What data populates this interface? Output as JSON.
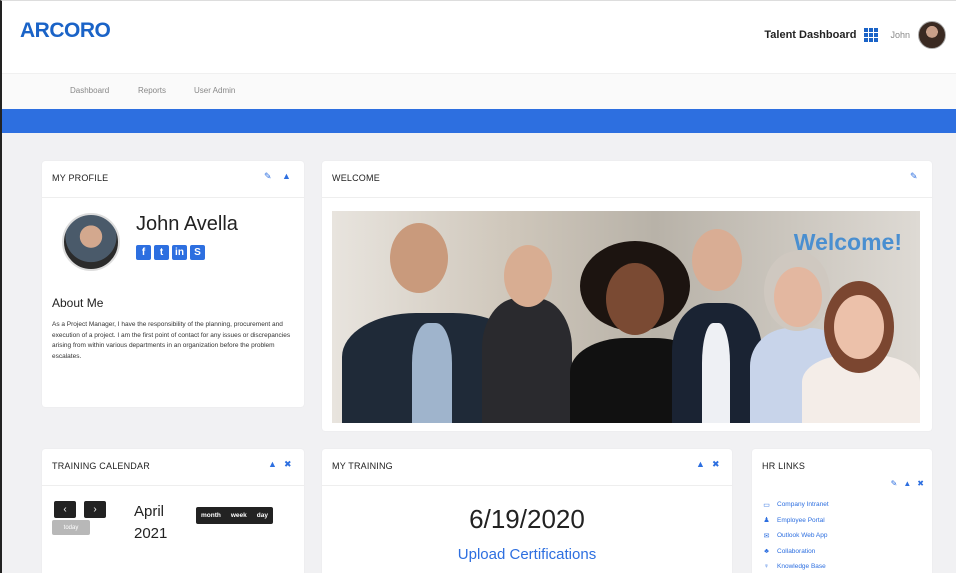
{
  "header": {
    "logo": "ARCORO",
    "dashboard_label": "Talent Dashboard",
    "user_name": "John"
  },
  "nav": {
    "items": [
      "Dashboard",
      "Reports",
      "User Admin"
    ]
  },
  "profile": {
    "title": "MY PROFILE",
    "name": "John Avella",
    "social": [
      "f",
      "t",
      "in",
      "S"
    ],
    "about_heading": "About Me",
    "about_text": "As a Project Manager, I have the responsibility of the planning, procurement and execution of a project. I am the first point of contact for any issues or discrepancies arising from within various departments in an organization before the problem escalates."
  },
  "welcome": {
    "title": "WELCOME",
    "banner_text": "Welcome!"
  },
  "calendar": {
    "title": "TRAINING CALENDAR",
    "prev": "‹",
    "next": "›",
    "today": "today",
    "month": "April",
    "year": "2021",
    "views": [
      "month",
      "week",
      "day"
    ]
  },
  "training": {
    "title": "MY TRAINING",
    "date": "6/19/2020",
    "link": "Upload Certifications"
  },
  "hr_links": {
    "title": "HR LINKS",
    "items": [
      {
        "icon": "monitor-icon",
        "glyph": "▭",
        "label": "Company Intranet"
      },
      {
        "icon": "person-icon",
        "glyph": "♟",
        "label": "Employee Portal"
      },
      {
        "icon": "mail-icon",
        "glyph": "✉",
        "label": "Outlook Web App"
      },
      {
        "icon": "group-icon",
        "glyph": "♣",
        "label": "Collaboration"
      },
      {
        "icon": "bulb-icon",
        "glyph": "♀",
        "label": "Knowledge Base"
      }
    ]
  },
  "colors": {
    "brand": "#1a63c7",
    "accent": "#2d6fe0",
    "background": "#f1f1f3"
  }
}
